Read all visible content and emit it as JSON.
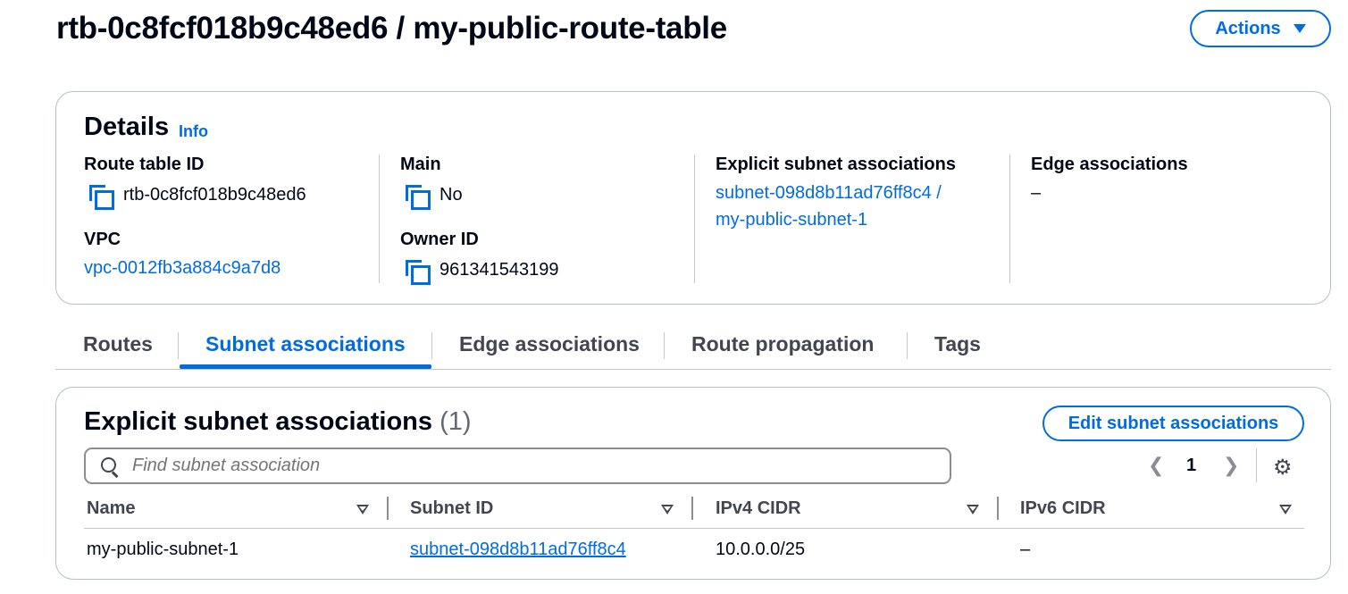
{
  "header": {
    "title": "rtb-0c8fcf018b9c48ed6 / my-public-route-table",
    "actions_label": "Actions"
  },
  "details": {
    "title": "Details",
    "info_label": "Info",
    "route_table_id_label": "Route table ID",
    "route_table_id": "rtb-0c8fcf018b9c48ed6",
    "vpc_label": "VPC",
    "vpc_value": "vpc-0012fb3a884c9a7d8",
    "main_label": "Main",
    "main_value": "No",
    "owner_id_label": "Owner ID",
    "owner_id": "961341543199",
    "explicit_label": "Explicit subnet associations",
    "explicit_line1": "subnet-098d8b11ad76ff8c4 /",
    "explicit_line2": "my-public-subnet-1",
    "edge_label": "Edge associations",
    "edge_value": "–"
  },
  "tabs": [
    {
      "label": "Routes",
      "active": false
    },
    {
      "label": "Subnet associations",
      "active": true
    },
    {
      "label": "Edge associations",
      "active": false
    },
    {
      "label": "Route propagation",
      "active": false
    },
    {
      "label": "Tags",
      "active": false
    }
  ],
  "associations": {
    "title": "Explicit subnet associations",
    "count": "(1)",
    "edit_label": "Edit subnet associations",
    "search_placeholder": "Find subnet association",
    "page_number": "1",
    "columns": [
      "Name",
      "Subnet ID",
      "IPv4 CIDR",
      "IPv6 CIDR"
    ],
    "rows": [
      {
        "name": "my-public-subnet-1",
        "subnet_id": "subnet-098d8b11ad76ff8c4",
        "ipv4": "10.0.0.0/25",
        "ipv6": "–"
      }
    ]
  },
  "icons": {
    "copy": "copy-icon",
    "search": "search-icon",
    "settings": "gear-icon",
    "prev": "chevron-left-icon",
    "next": "chevron-right-icon",
    "sort": "sort-down-icon",
    "caret": "caret-down-icon"
  },
  "colors": {
    "accent": "#006ce0",
    "text": "#000716",
    "secondary_text": "#424650",
    "border": "#b6bec9"
  }
}
